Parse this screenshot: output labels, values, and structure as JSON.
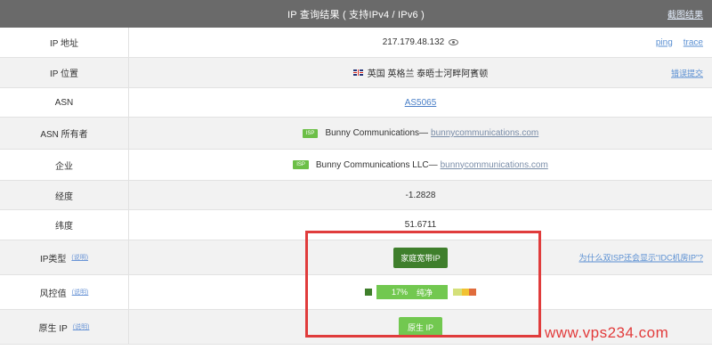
{
  "header": {
    "title": "IP 查询结果 ( 支持IPv4 / IPv6 )",
    "back_link": "截图结果"
  },
  "rows": {
    "ip_address": {
      "label": "IP 地址",
      "value": "217.179.48.132",
      "link_ping": "ping",
      "link_trace": "trace"
    },
    "ip_location": {
      "label": "IP 位置",
      "value": "英国 英格兰 泰晤士河畔阿賓顿",
      "link_report": "错误提交"
    },
    "asn": {
      "label": "ASN",
      "value": "AS5065"
    },
    "asn_owner": {
      "label": "ASN 所有者",
      "badge": "ISP",
      "name": "Bunny Communications—",
      "domain": "bunnycommunications.com"
    },
    "company": {
      "label": "企业",
      "badge": "ISP",
      "name": "Bunny Communications LLC—",
      "domain": "bunnycommunications.com"
    },
    "longitude": {
      "label": "经度",
      "value": "-1.2828"
    },
    "latitude": {
      "label": "纬度",
      "value": "51.6711"
    },
    "ip_type": {
      "label": "IP类型",
      "help": "(说明)",
      "value": "家庭宽带IP",
      "why_link": "为什么双ISP还会显示“IDC机房IP”?"
    },
    "risk": {
      "label": "风控值",
      "help": "(说明)",
      "percent": "17%",
      "level": "纯净",
      "percent_value": 17
    },
    "native_ip": {
      "label": "原生 IP",
      "help": "(说明)",
      "value": "原生 IP"
    }
  },
  "watermark": "www.vps234.com",
  "colors": {
    "header_bg": "#6a6a6a",
    "highlight_border": "#e03c3c",
    "green_dark": "#3f7f2c",
    "green": "#72c850",
    "watermark": "#e23b3b"
  }
}
